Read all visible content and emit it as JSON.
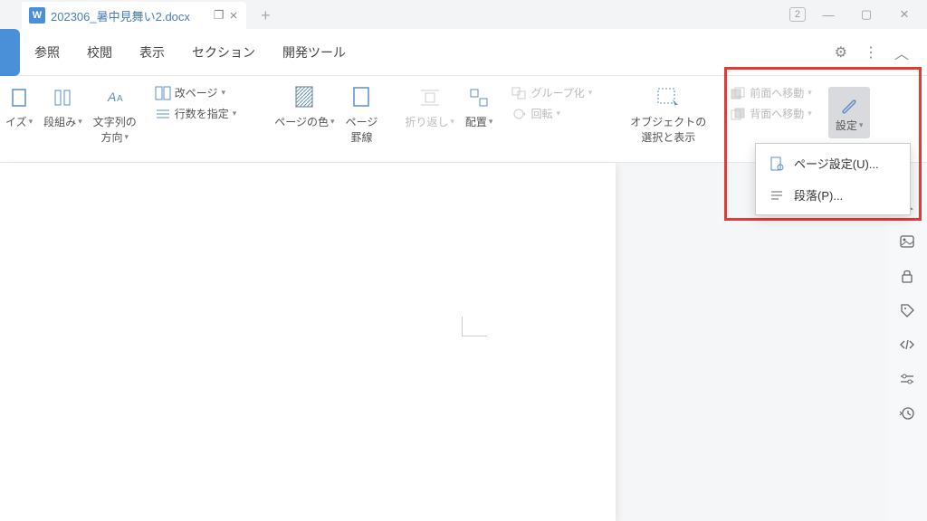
{
  "titlebar": {
    "filename": "202306_暑中見舞い2.docx",
    "badge": "2"
  },
  "menubar": {
    "items": [
      "参照",
      "校閲",
      "表示",
      "セクション",
      "開発ツール"
    ]
  },
  "ribbon": {
    "size": "イズ",
    "columns": "段組み",
    "text_dir": "文字列の",
    "text_dir2": "方向",
    "page_break": "改ページ",
    "line_count": "行数を指定",
    "page_color": "ページの色",
    "page_border": "ページ",
    "page_border2": "罫線",
    "wrap": "折り返し",
    "align": "配置",
    "group": "グループ化",
    "rotate": "回転",
    "select_obj": "オブジェクトの",
    "select_obj2": "選択と表示",
    "bring_front": "前面へ移動",
    "send_back": "背面へ移動",
    "settings": "設定"
  },
  "dropdown": {
    "page_setup": "ページ設定(U)...",
    "paragraph": "段落(P)..."
  }
}
